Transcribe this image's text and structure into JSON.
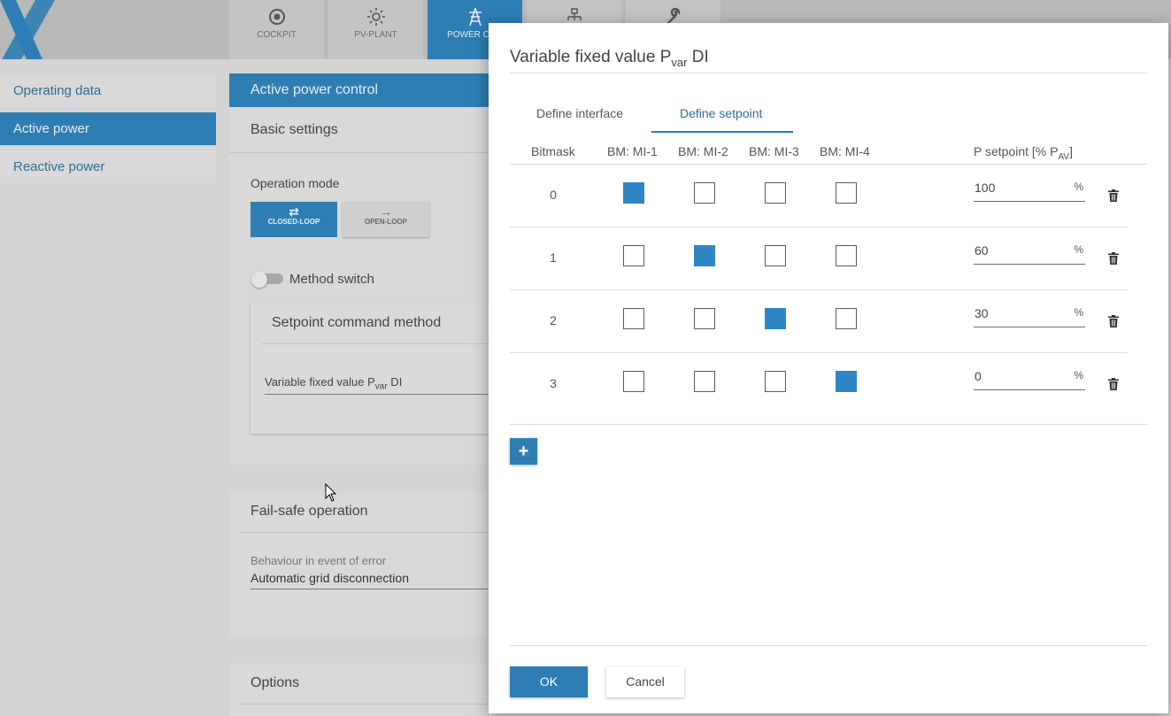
{
  "nav": {
    "tabs": [
      {
        "label": "COCKPIT",
        "icon": "target-icon"
      },
      {
        "label": "PV-PLANT",
        "icon": "sun-icon"
      },
      {
        "label": "POWER CON",
        "icon": "power-tower-icon"
      },
      {
        "label": "",
        "icon": "hierarchy-icon"
      },
      {
        "label": "",
        "icon": "wrench-icon"
      }
    ]
  },
  "sidebar": {
    "items": [
      {
        "label": "Operating data"
      },
      {
        "label": "Active power"
      },
      {
        "label": "Reactive power"
      }
    ]
  },
  "main": {
    "header": "Active power control",
    "basic_settings": "Basic settings",
    "operation_mode_label": "Operation mode",
    "closed_loop": "CLOSED-LOOP",
    "open_loop": "OPEN-LOOP",
    "method_switch": "Method switch",
    "setpoint_method": "Setpoint command method",
    "method_value_main": "Variable fixed value P",
    "method_value_sub": "var",
    "method_value_tail": " DI",
    "fail_safe": "Fail-safe operation",
    "behaviour_label": "Behaviour in event of error",
    "behaviour_value": "Automatic grid disconnection",
    "options": "Options"
  },
  "dialog": {
    "title_main": "Variable fixed value P",
    "title_sub": "var",
    "title_tail": " DI",
    "tabs": [
      "Define interface",
      "Define setpoint"
    ],
    "headers": {
      "bitmask": "Bitmask",
      "bm1": "BM: MI-1",
      "bm2": "BM: MI-2",
      "bm3": "BM: MI-3",
      "bm4": "BM: MI-4",
      "setpoint_main": "P setpoint [% P",
      "setpoint_sub": "AV",
      "setpoint_tail": "]"
    },
    "rows": [
      {
        "bitmask": "0",
        "checks": [
          true,
          false,
          false,
          false
        ],
        "value": "100",
        "unit": "%"
      },
      {
        "bitmask": "1",
        "checks": [
          false,
          true,
          false,
          false
        ],
        "value": "60",
        "unit": "%"
      },
      {
        "bitmask": "2",
        "checks": [
          false,
          false,
          true,
          false
        ],
        "value": "30",
        "unit": "%"
      },
      {
        "bitmask": "3",
        "checks": [
          false,
          false,
          false,
          true
        ],
        "value": "0",
        "unit": "%"
      }
    ],
    "add_label": "+",
    "ok_label": "OK",
    "cancel_label": "Cancel"
  },
  "colors": {
    "accent": "#2e7eb4",
    "checked": "#2e85c4"
  }
}
